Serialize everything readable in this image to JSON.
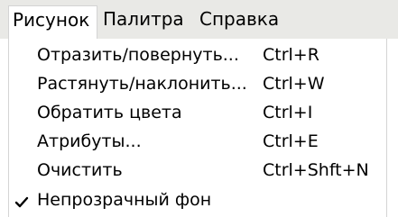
{
  "menubar": {
    "items": [
      {
        "label": "Рисунок"
      },
      {
        "label": "Палитра"
      },
      {
        "label": "Справка"
      }
    ]
  },
  "dropdown": {
    "items": [
      {
        "label": "Отразить/повернуть...",
        "shortcut": "Ctrl+R"
      },
      {
        "label": "Растянуть/наклонить...",
        "shortcut": "Ctrl+W"
      },
      {
        "label": "Обратить цвета",
        "shortcut": "Ctrl+I"
      },
      {
        "label": "Атрибуты...",
        "shortcut": "Ctrl+E"
      },
      {
        "label": "Очистить",
        "shortcut": "Ctrl+Shft+N"
      },
      {
        "label": "Непрозрачный фон",
        "checked": true,
        "icon": "checkmark-icon"
      }
    ]
  }
}
